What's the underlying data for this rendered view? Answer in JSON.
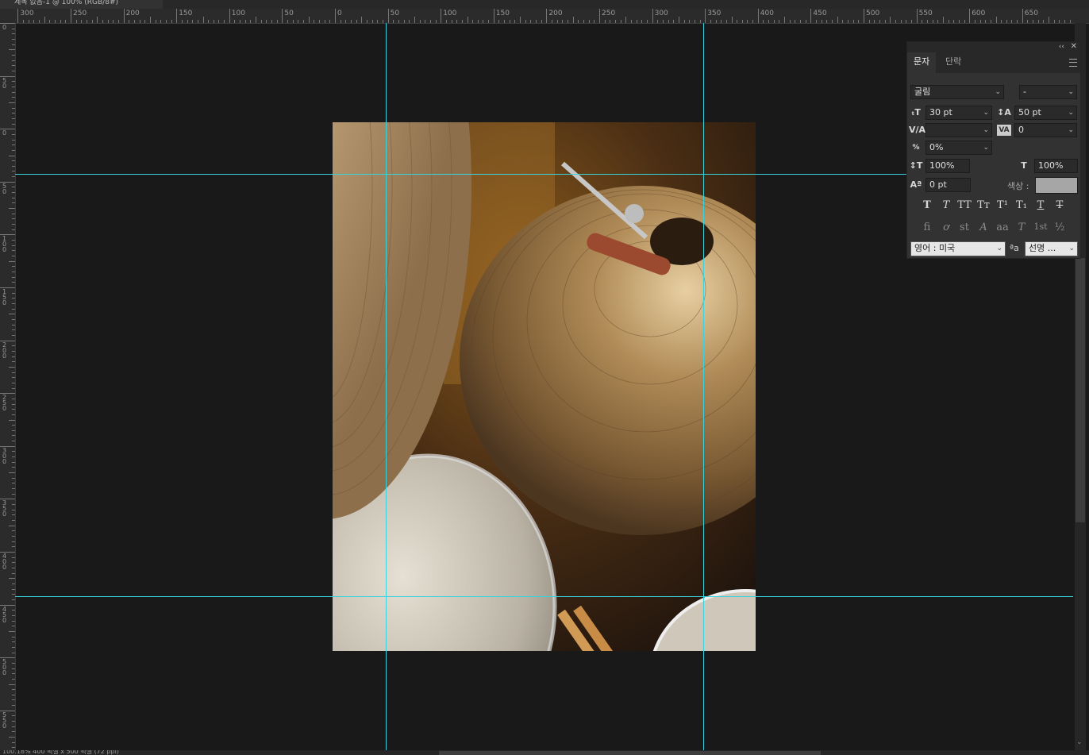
{
  "document": {
    "tab_label": "제목 없음-1 @ 100% (RGB/8#)"
  },
  "status": {
    "text": "100.18%    400 픽셀 x 500 픽셀 (72 ppi)"
  },
  "rulers": {
    "horizontal": [
      "300",
      "250",
      "200",
      "150",
      "100",
      "50",
      "0",
      "50",
      "100",
      "150",
      "200",
      "250",
      "300",
      "350",
      "400",
      "450",
      "500",
      "550",
      "600",
      "650"
    ],
    "vertical": [
      "0",
      "50",
      "0",
      "50",
      "100",
      "150",
      "200",
      "250",
      "300",
      "350",
      "400",
      "450",
      "500",
      "550"
    ]
  },
  "guides": {
    "color": "#37d3df"
  },
  "character_panel": {
    "collapse_glyph": "‹‹",
    "close_glyph": "✕",
    "tabs": [
      {
        "label": "문자"
      },
      {
        "label": "단락"
      }
    ],
    "font_family": "굴림",
    "font_style": "-",
    "font_size": "30 pt",
    "leading": "50 pt",
    "kerning": "",
    "tracking": "0",
    "tsume": "0%",
    "vertical_scale": "100%",
    "horizontal_scale": "100%",
    "baseline_shift": "0 pt",
    "color_label": "색상 :",
    "color_value": "#a6a6a6",
    "language": "영어 : 미국",
    "antialias_label": "ªa",
    "antialias": "선명 ...",
    "style_buttons": [
      "T",
      "T",
      "TT",
      "Tᴛ",
      "T¹",
      "T₁",
      "T",
      "T"
    ],
    "opentype_buttons": [
      "fi",
      "ơ",
      "st",
      "A",
      "aa",
      "T",
      "1st",
      "½"
    ]
  }
}
